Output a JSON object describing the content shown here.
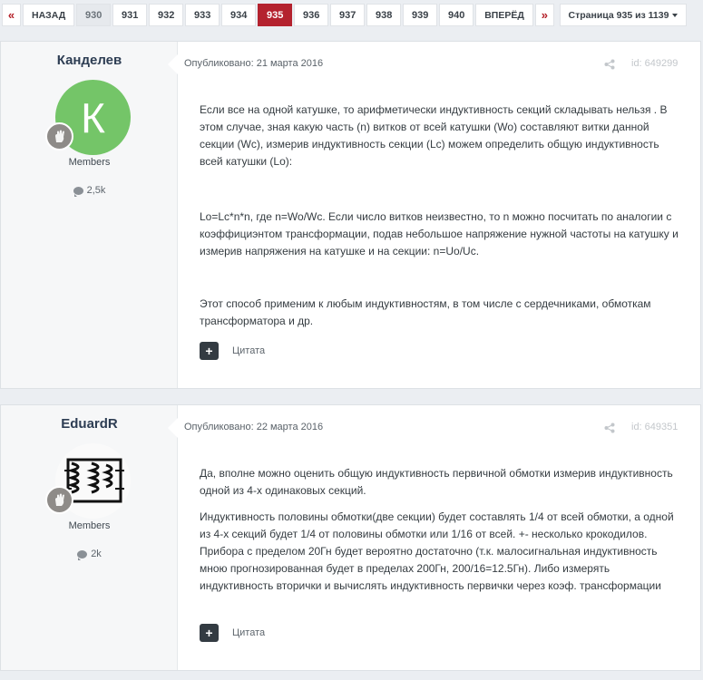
{
  "pagination": {
    "first_icon": "double-left-arrow-icon",
    "prev_label": "НАЗАД",
    "pages": [
      "930",
      "931",
      "932",
      "933",
      "934",
      "935",
      "936",
      "937",
      "938",
      "939",
      "940"
    ],
    "active_page": "935",
    "next_label": "ВПЕРЁД",
    "last_icon": "double-right-arrow-icon",
    "page_info": "Страница 935 из 1139"
  },
  "colors": {
    "accent": "#b4222e",
    "avatar_green": "#74c568"
  },
  "posts": [
    {
      "author": "Канделев",
      "avatar_letter": "К",
      "group": "Members",
      "post_count": "2,5k",
      "published": "Опубликовано: 21 марта 2016",
      "post_id": "id: 649299",
      "paragraphs": [
        "Если все на одной катушке, то арифметически индуктивность секций складывать нельзя . В этом случае, зная какую часть (n) витков от всей катушки (Wo) составляют витки данной секции (Wc), измерив индуктивность секции (Lc) можем определить общую индуктивность всей катушки (Lo):",
        "Lo=Lc*n*n, где n=Wo/Wc. Если число витков неизвестно, то n можно посчитать по аналогии с коэффициэнтом трансформации, подав небольшое напряжение нужной частоты на катушку и измерив напряжения на катушке и на секции: n=Uo/Uc.",
        "Этот способ применим к любым индуктивностям, в том числе с сердечниками, обмоткам трансформатора и др."
      ],
      "quote_label": "Цитата"
    },
    {
      "author": "EduardR",
      "group": "Members",
      "post_count": "2k",
      "published": "Опубликовано: 22 марта 2016",
      "post_id": "id: 649351",
      "paragraphs": [
        "Да, вполне можно оценить общую индуктивность первичной обмотки измерив индуктивность одной из 4-х одинаковых секций.",
        "Индуктивность половины обмотки(две секции) будет составлять 1/4 от всей обмотки, а одной из 4-х секций будет 1/4 от половины обмотки или 1/16 от всей. +- несколько крокодилов. Прибора с пределом 20Гн будет вероятно достаточно (т.к. малосигнальная индуктивность мною прогнозированная будет в пределах 200Гн, 200/16=12.5Гн). Либо измерять индуктивность вторички и вычислять индуктивность первички через коэф. трансформации"
      ],
      "quote_label": "Цитата"
    }
  ]
}
